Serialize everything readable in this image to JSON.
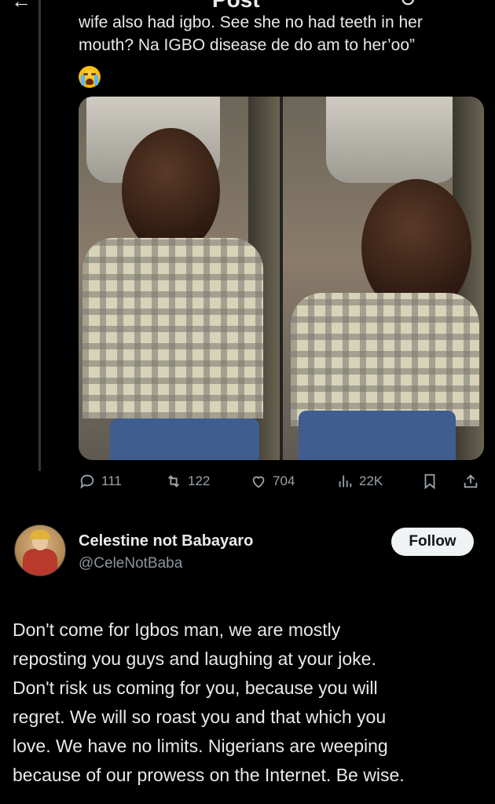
{
  "header": {
    "title": "Post"
  },
  "tweet": {
    "lines": [
      "wife also had igbo. See she no had teeth in her",
      "mouth? Na IGBO disease de do am to her’oo”"
    ],
    "emoji": "loudly-crying-face",
    "stats": {
      "replies": "111",
      "reposts": "122",
      "likes": "704",
      "views": "22K"
    }
  },
  "reply": {
    "display_name": "Celestine not Babayaro",
    "handle": "@CeleNotBaba",
    "follow_label": "Follow",
    "lines": [
      "Don't come for Igbos man, we are mostly",
      "reposting you guys and laughing at your joke.",
      "Don't risk us coming for you, because you will",
      "regret. We will so roast you and that which you",
      "love. We have no limits. Nigerians are weeping",
      "because of our prowess on the Internet. Be wise."
    ]
  },
  "colors": {
    "background": "#000000",
    "text": "#e7e9ea",
    "muted": "#8b949c",
    "button_bg": "#eff3f4"
  }
}
